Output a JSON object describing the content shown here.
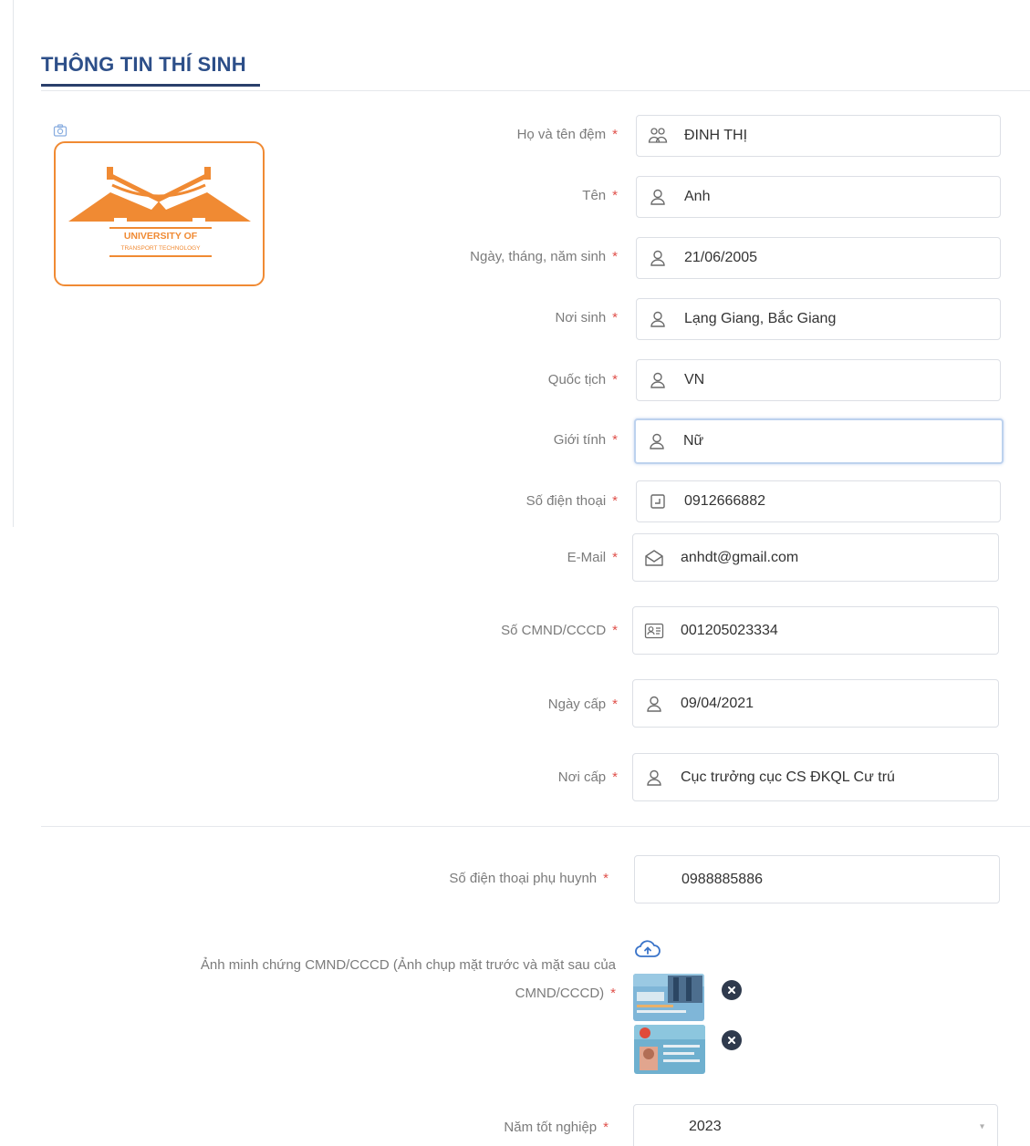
{
  "section": {
    "title": "THÔNG TIN THÍ SINH"
  },
  "logo": {
    "line1": "UNIVERSITY OF",
    "line2": "TRANSPORT TECHNOLOGY",
    "accent": "#f08a33"
  },
  "required_mark": "*",
  "fields": [
    {
      "label": "Họ và tên đệm",
      "value": "ĐINH THỊ",
      "icon": "users-icon"
    },
    {
      "label": "Tên",
      "value": "Anh",
      "icon": "user-icon"
    },
    {
      "label": "Ngày, tháng, năm sinh",
      "value": "21/06/2005",
      "icon": "user-icon"
    },
    {
      "label": "Nơi sinh",
      "value": "Lạng Giang, Bắc Giang",
      "icon": "user-icon"
    },
    {
      "label": "Quốc tịch",
      "value": "VN",
      "icon": "user-icon"
    },
    {
      "label": "Giới tính",
      "value": "Nữ",
      "icon": "user-icon"
    },
    {
      "label": "Số điện thoại",
      "value": "0912666882",
      "icon": "phone-icon"
    },
    {
      "label": "E-Mail",
      "value": "anhdt@gmail.com",
      "icon": "mail-icon"
    },
    {
      "label": "Số CMND/CCCD",
      "value": "001205023334",
      "icon": "id-card-icon"
    },
    {
      "label": "Ngày cấp",
      "value": "09/04/2021",
      "icon": "user-icon"
    },
    {
      "label": "Nơi cấp",
      "value": "Cục trưởng cục CS ĐKQL Cư trú",
      "icon": "user-icon"
    }
  ],
  "parent_phone": {
    "label": "Số điện thoại phụ huynh",
    "value": "0988885886"
  },
  "id_proof": {
    "label_line1": "Ảnh minh chứng CMND/CCCD (Ảnh chụp mặt trước và mặt sau của",
    "label_line2": "CMND/CCCD)"
  },
  "graduation_year": {
    "label": "Năm tốt nghiệp",
    "value": "2023"
  },
  "colors": {
    "title": "#2d4f89",
    "required": "#e0504a",
    "icon": "#6a6a6a",
    "link_icon": "#3a74c9"
  }
}
